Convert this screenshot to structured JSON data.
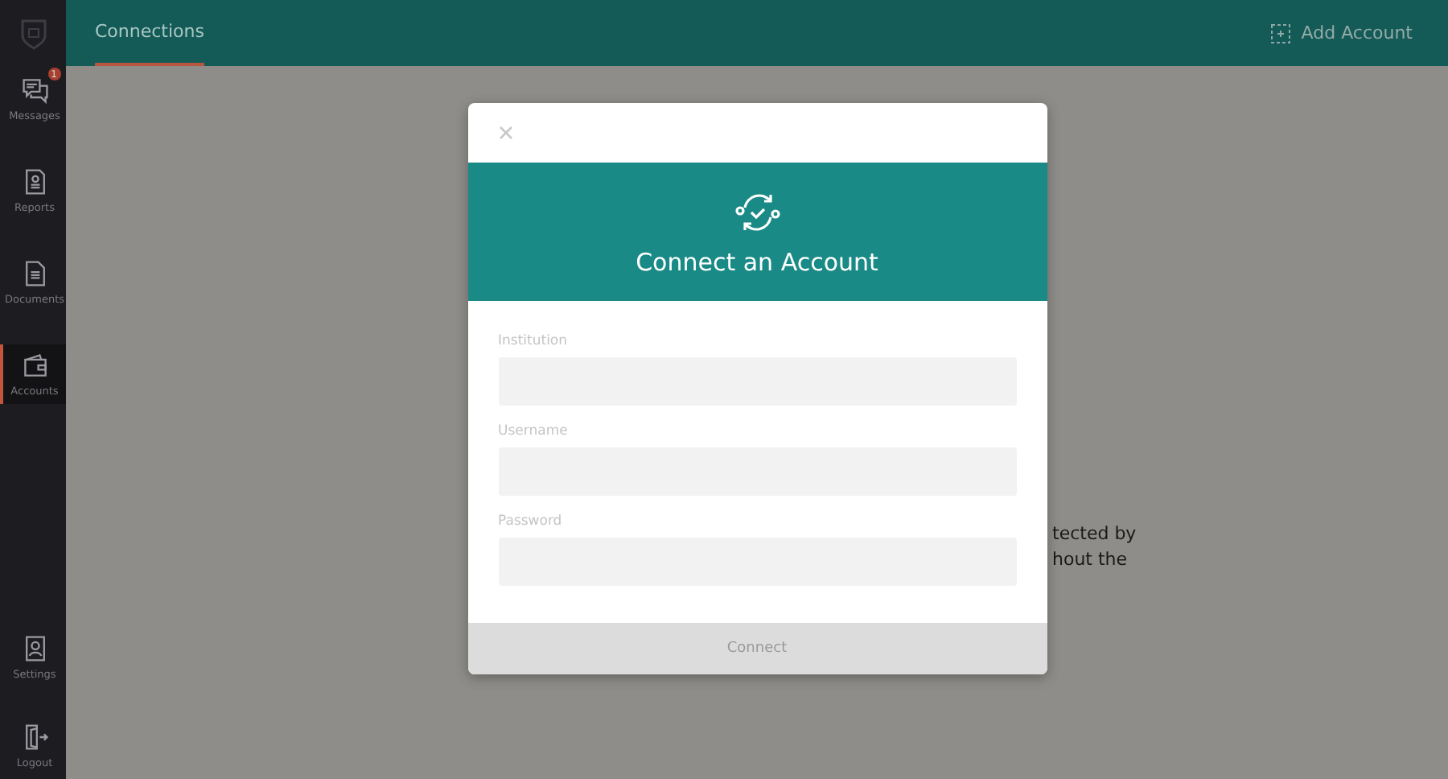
{
  "sidebar": {
    "items": [
      {
        "label": "Messages",
        "badge": "1",
        "selected": false
      },
      {
        "label": "Reports",
        "selected": false
      },
      {
        "label": "Documents",
        "selected": false
      },
      {
        "label": "Accounts",
        "selected": true
      }
    ],
    "bottom_items": [
      {
        "label": "Settings"
      },
      {
        "label": "Logout"
      }
    ]
  },
  "top_bar": {
    "tabs": [
      {
        "label": "Connections",
        "selected": true
      }
    ],
    "action": "Add Account"
  },
  "background_text": [
    "tected by",
    "hout the"
  ],
  "dialog": {
    "title": "Connect an Account",
    "fields": [
      {
        "label": "Institution"
      },
      {
        "label": "Username"
      },
      {
        "label": "Password"
      }
    ],
    "button": "Connect"
  }
}
